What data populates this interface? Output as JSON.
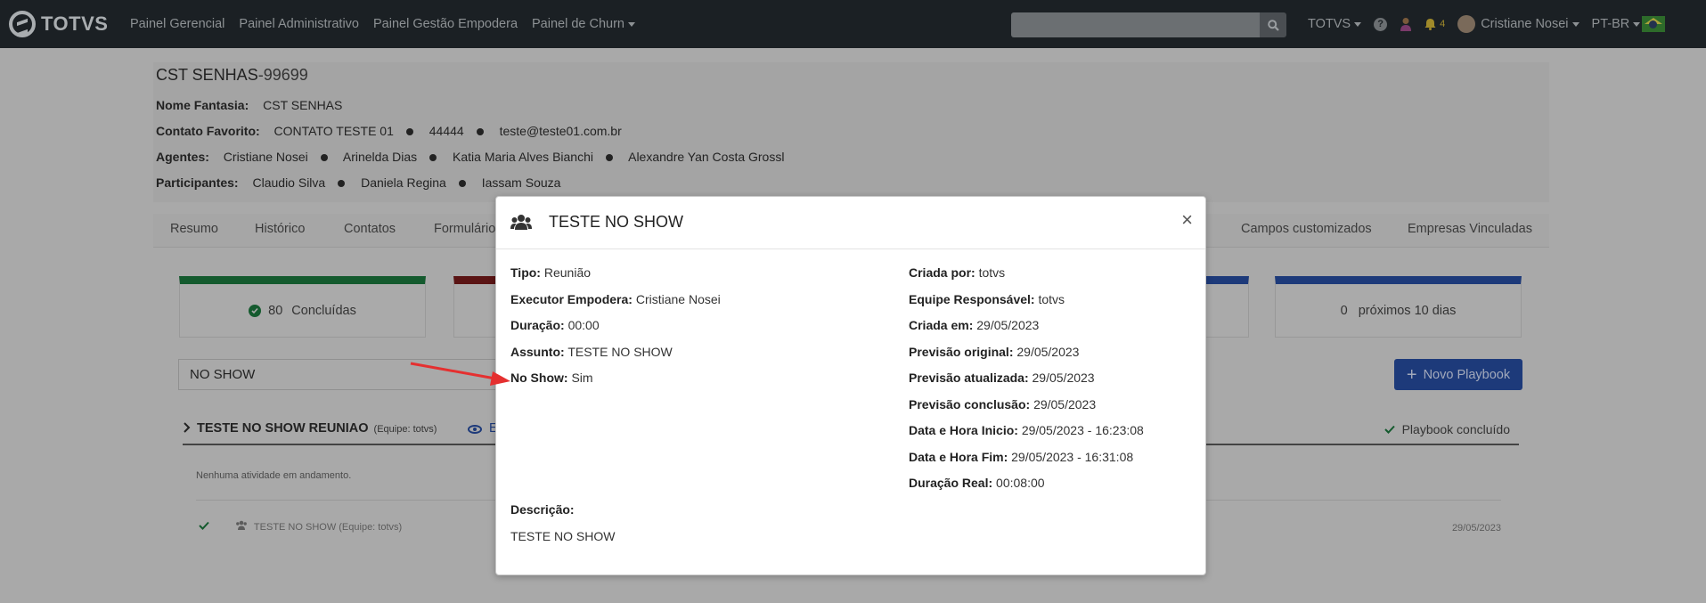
{
  "navbar": {
    "brand": "TOTVS",
    "menu": [
      "Painel Gerencial",
      "Painel Administrativo",
      "Painel Gestão Empodera",
      "Painel de Churn"
    ],
    "search": {
      "value": "",
      "placeholder": ""
    },
    "company": "TOTVS",
    "notifications_count": "4",
    "user_name": "Cristiane Nosei",
    "language": "PT-BR"
  },
  "customer": {
    "name": "CST SENHAS",
    "code": "-99699",
    "fantasy_label": "Nome Fantasia:",
    "fantasy_value": "CST SENHAS",
    "contact_label": "Contato Favorito:",
    "contact_name": "CONTATO TESTE 01",
    "contact_phone": "44444",
    "contact_email": "teste@teste01.com.br",
    "agents_label": "Agentes:",
    "agents": [
      "Cristiane Nosei",
      "Arinelda Dias",
      "Katia Maria Alves Bianchi",
      "Alexandre Yan Costa Grossl"
    ],
    "participants_label": "Participantes:",
    "participants": [
      "Claudio Silva",
      "Daniela Regina",
      "Iassam Souza"
    ]
  },
  "tabs": [
    "Resumo",
    "Histórico",
    "Contatos",
    "Formulário",
    "Campos customizados",
    "Empresas Vinculadas"
  ],
  "stats": {
    "completed_count": "80",
    "completed_label": "Concluídas",
    "upcoming_count": "0",
    "upcoming_label": "próximos 10 dias"
  },
  "filter": {
    "value": "NO SHOW"
  },
  "new_playbook_label": "Novo Playbook",
  "playbook": {
    "title": "TESTE NO SHOW REUNIAO",
    "team": "(Equipe: totvs)",
    "eye_partial": "E",
    "status": "Playbook concluído",
    "empty_message": "Nenhuma atividade em andamento.",
    "activity_title": "TESTE NO SHOW",
    "activity_team": "(Equipe: totvs)",
    "activity_date": "29/05/2023"
  },
  "modal": {
    "title": "TESTE NO SHOW",
    "close": "×",
    "left": [
      {
        "label": "Tipo:",
        "value": "Reunião"
      },
      {
        "label": "Executor Empodera:",
        "value": "Cristiane Nosei"
      },
      {
        "label": "Duração:",
        "value": "00:00"
      },
      {
        "label": "Assunto:",
        "value": "TESTE NO SHOW"
      },
      {
        "label": "No Show:",
        "value": "Sim"
      }
    ],
    "right": [
      {
        "label": "Criada por:",
        "value": "totvs"
      },
      {
        "label": "Equipe Responsável:",
        "value": "totvs"
      },
      {
        "label": "Criada em:",
        "value": "29/05/2023"
      },
      {
        "label": "Previsão original:",
        "value": "29/05/2023"
      },
      {
        "label": "Previsão atualizada:",
        "value": "29/05/2023"
      },
      {
        "label": "Previsão conclusão:",
        "value": "29/05/2023"
      },
      {
        "label": "Data e Hora Inicio:",
        "value": "29/05/2023 - 16:23:08"
      },
      {
        "label": "Data e Hora Fim:",
        "value": "29/05/2023 - 16:31:08"
      },
      {
        "label": "Duração Real:",
        "value": "00:08:00"
      }
    ],
    "description_label": "Descrição:",
    "description_value": "TESTE NO SHOW"
  },
  "colors": {
    "navbar": "#1b2024",
    "primary": "#2a5ac4",
    "success": "#1a8a44",
    "danger": "#c8282a",
    "annotation_arrow": "#e53030"
  }
}
